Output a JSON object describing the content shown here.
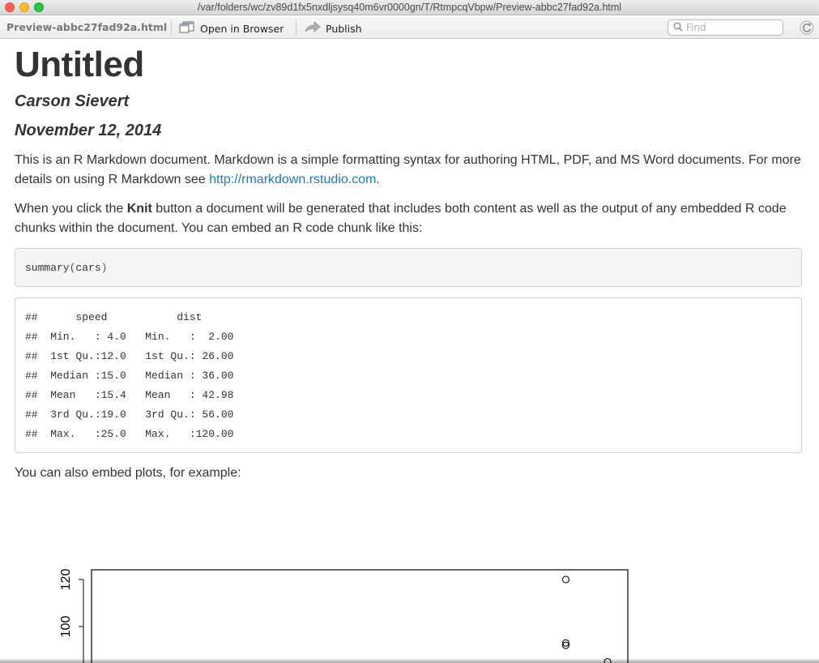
{
  "window": {
    "title": "/var/folders/wc/zv89d1fx5nxdljsysq40m6vr0000gn/T/RtmpcqVbpw/Preview-abbc27fad92a.html"
  },
  "toolbar": {
    "filename": "Preview-abbc27fad92a.html",
    "open_in_browser_label": "Open in Browser",
    "publish_label": "Publish",
    "find_placeholder": "Find"
  },
  "document": {
    "title": "Untitled",
    "author": "Carson Sievert",
    "date": "November 12, 2014",
    "para1_text": "This is an R Markdown document. Markdown is a simple formatting syntax for authoring HTML, PDF, and MS Word documents. For more details on using R Markdown see ",
    "para1_link": "http://rmarkdown.rstudio.com",
    "para1_end": ".",
    "para2_pre": "When you click the ",
    "para2_bold": "Knit",
    "para2_post": " button a document will be generated that includes both content as well as the output of any embedded R code chunks within the document. You can embed an R code chunk like this:",
    "code_fn": "summary",
    "code_open": "(",
    "code_arg": "cars",
    "code_close": ")",
    "output_lines": [
      "##      speed           dist       ",
      "##  Min.   : 4.0   Min.   :  2.00  ",
      "##  1st Qu.:12.0   1st Qu.: 26.00  ",
      "##  Median :15.0   Median : 36.00  ",
      "##  Mean   :15.4   Mean   : 42.98  ",
      "##  3rd Qu.:19.0   3rd Qu.: 56.00  ",
      "##  Max.   :25.0   Max.   :120.00  "
    ],
    "para3": "You can also embed plots, for example:"
  },
  "chart_data": {
    "type": "scatter",
    "title": "",
    "xlabel": "",
    "ylabel": "",
    "y_ticks": [
      100,
      120
    ],
    "ylim": [
      90,
      125
    ],
    "xlim": [
      3,
      26
    ],
    "x": [
      24,
      24,
      24,
      25
    ],
    "y": [
      120,
      93,
      92,
      85
    ]
  }
}
